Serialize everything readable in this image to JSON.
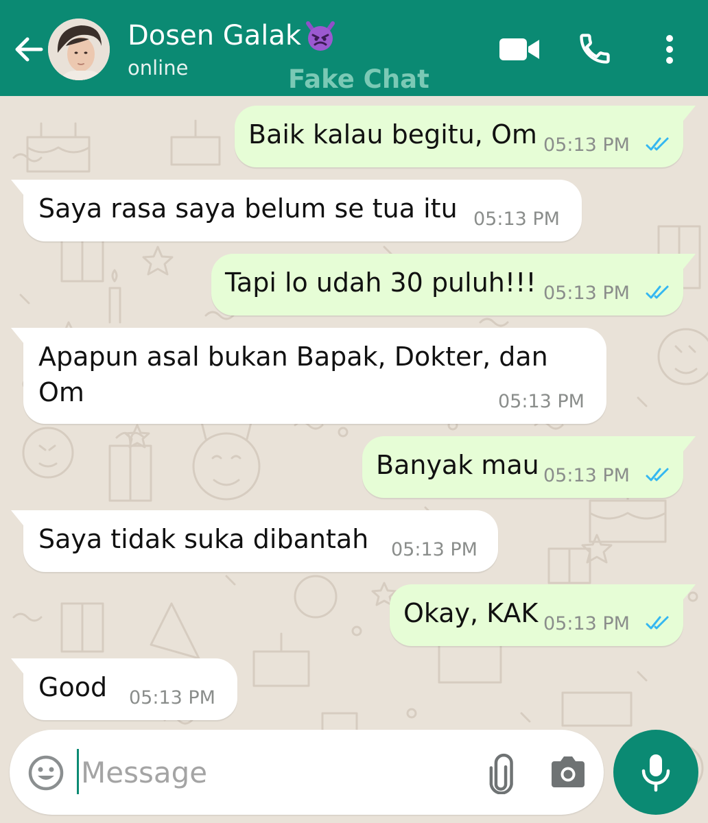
{
  "header": {
    "contact_name": "Dosen Galak",
    "status": "online",
    "watermark": "Fake Chat"
  },
  "messages": [
    {
      "direction": "out",
      "text": "Baik kalau begitu, Om",
      "time": "05:13 PM",
      "read": true
    },
    {
      "direction": "in",
      "text": "Saya rasa saya belum se tua itu",
      "time": "05:13 PM"
    },
    {
      "direction": "out",
      "text": "Tapi lo udah 30 puluh!!!",
      "time": "05:13 PM",
      "read": true
    },
    {
      "direction": "in",
      "text": "Apapun asal bukan Bapak, Dokter, dan Om",
      "time": "05:13 PM"
    },
    {
      "direction": "out",
      "text": "Banyak mau",
      "time": "05:13 PM",
      "read": true
    },
    {
      "direction": "in",
      "text": "Saya tidak suka dibantah",
      "time": "05:13 PM"
    },
    {
      "direction": "out",
      "text": "Okay, KAK",
      "time": "05:13 PM",
      "read": true
    },
    {
      "direction": "in",
      "text": "Good",
      "time": "05:13 PM"
    }
  ],
  "composer": {
    "placeholder": "Message"
  },
  "colors": {
    "header": "#0b8a73",
    "outgoing_bubble": "#e6fdd6",
    "incoming_bubble": "#ffffff",
    "read_ticks": "#34b7f1",
    "wallpaper": "#e9e2d8"
  },
  "icons": {
    "back": "arrow-left-icon",
    "video": "video-camera-icon",
    "call": "phone-icon",
    "menu": "more-vertical-icon",
    "emoji": "smiley-icon",
    "attach": "paperclip-icon",
    "camera": "camera-icon",
    "mic": "microphone-icon",
    "name_emoji": "devil-face-icon"
  }
}
